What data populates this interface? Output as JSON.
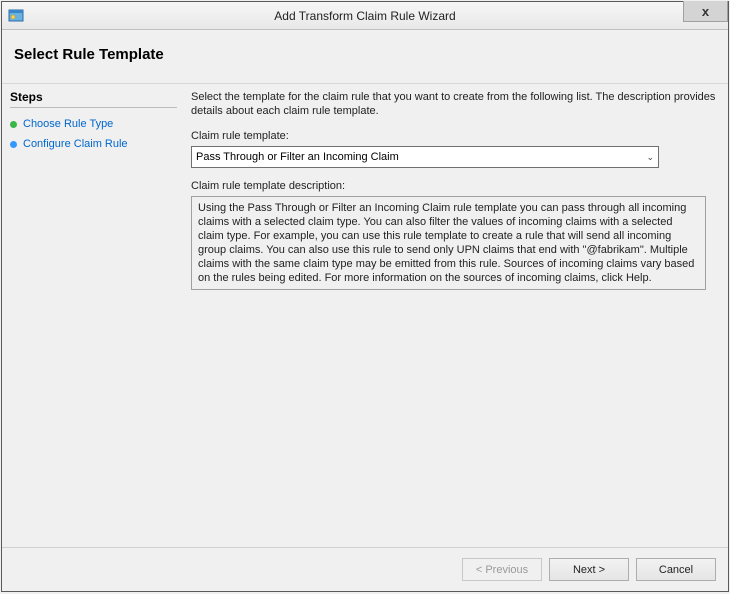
{
  "window": {
    "title": "Add Transform Claim Rule Wizard"
  },
  "header": {
    "title": "Select Rule Template"
  },
  "sidebar": {
    "heading": "Steps",
    "items": [
      {
        "label": "Choose Rule Type"
      },
      {
        "label": "Configure Claim Rule"
      }
    ]
  },
  "content": {
    "intro": "Select the template for the claim rule that you want to create from the following list. The description provides details about each claim rule template.",
    "template_label": "Claim rule template:",
    "template_value": "Pass Through or Filter an Incoming Claim",
    "description_label": "Claim rule template description:",
    "description_text": "Using the Pass Through or Filter an Incoming Claim rule template you can pass through all incoming claims with a selected claim type.  You can also filter the values of incoming claims with a selected claim type.  For example, you can use this rule template to create a rule that will send all incoming group claims.  You can also use this rule to send only UPN claims that end with \"@fabrikam\".  Multiple claims with the same claim type may be emitted from this rule.  Sources of incoming claims vary based on the rules being edited.  For more information on the sources of incoming claims, click Help."
  },
  "footer": {
    "previous": "< Previous",
    "next": "Next >",
    "cancel": "Cancel"
  }
}
